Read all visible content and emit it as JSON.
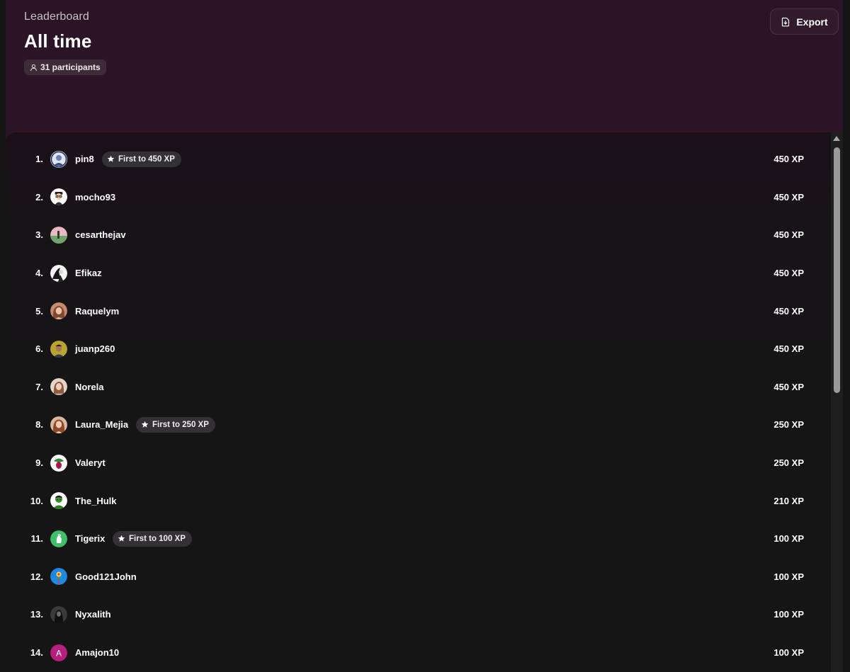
{
  "header": {
    "eyebrow": "Leaderboard",
    "title": "All time",
    "participants_label": "31 participants",
    "export_label": "Export"
  },
  "colors": {
    "header_bg": "#2b1425",
    "list_bg": "#151515",
    "badge_bg": "#333133",
    "text": "#ffffff"
  },
  "icons": {
    "participants": "person-icon",
    "export": "file-export-icon",
    "badge": "star-icon"
  },
  "entries": [
    {
      "rank": "1.",
      "name": "pin8",
      "xp": "450 XP",
      "badge": "First to 450 XP",
      "avatar": "avatar-pin8"
    },
    {
      "rank": "2.",
      "name": "mocho93",
      "xp": "450 XP",
      "badge": null,
      "avatar": "avatar-mocho93"
    },
    {
      "rank": "3.",
      "name": "cesarthejav",
      "xp": "450 XP",
      "badge": null,
      "avatar": "avatar-cesarthejav"
    },
    {
      "rank": "4.",
      "name": "Efikaz",
      "xp": "450 XP",
      "badge": null,
      "avatar": "avatar-efikaz"
    },
    {
      "rank": "5.",
      "name": "Raquelym",
      "xp": "450 XP",
      "badge": null,
      "avatar": "avatar-raquelym"
    },
    {
      "rank": "6.",
      "name": "juanp260",
      "xp": "450 XP",
      "badge": null,
      "avatar": "avatar-juanp260"
    },
    {
      "rank": "7.",
      "name": "Norela",
      "xp": "450 XP",
      "badge": null,
      "avatar": "avatar-norela"
    },
    {
      "rank": "8.",
      "name": "Laura_Mejia",
      "xp": "250 XP",
      "badge": "First to 250 XP",
      "avatar": "avatar-laura-mejia"
    },
    {
      "rank": "9.",
      "name": "Valeryt",
      "xp": "250 XP",
      "badge": null,
      "avatar": "avatar-valeryt"
    },
    {
      "rank": "10.",
      "name": "The_Hulk",
      "xp": "210 XP",
      "badge": null,
      "avatar": "avatar-the-hulk"
    },
    {
      "rank": "11.",
      "name": "Tigerix",
      "xp": "100 XP",
      "badge": "First to 100 XP",
      "avatar": "avatar-tigerix"
    },
    {
      "rank": "12.",
      "name": "Good121John",
      "xp": "100 XP",
      "badge": null,
      "avatar": "avatar-good121john"
    },
    {
      "rank": "13.",
      "name": "Nyxalith",
      "xp": "100 XP",
      "badge": null,
      "avatar": "avatar-nyxalith"
    },
    {
      "rank": "14.",
      "name": "Amajon10",
      "xp": "100 XP",
      "badge": null,
      "avatar": "avatar-amajon10",
      "initial": "A"
    }
  ]
}
